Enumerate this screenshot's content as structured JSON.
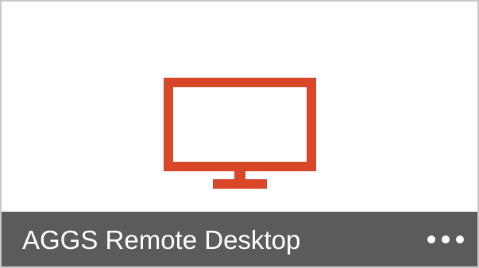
{
  "tile": {
    "title": "AGGS Remote Desktop",
    "icon": "monitor-icon",
    "accent_color": "#d9472b",
    "footer_color": "#5b5b5b",
    "border_color": "#c8c8c8",
    "more_icon": "more-horizontal-icon"
  }
}
